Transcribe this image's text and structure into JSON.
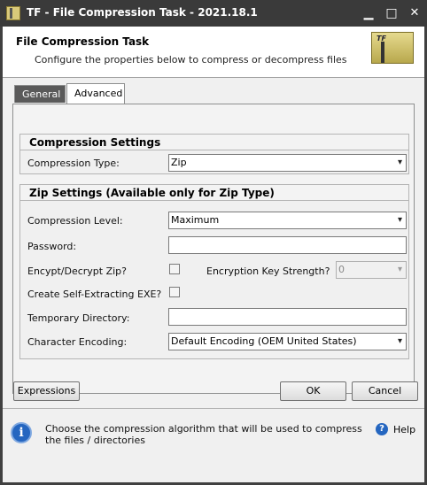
{
  "window": {
    "title": "TF - File Compression Task - 2021.18.1",
    "controls": {
      "minimize": "▁",
      "maximize": "□",
      "close": "✕"
    }
  },
  "header": {
    "title": "File Compression Task",
    "subtitle": "Configure the properties below to compress or decompress files"
  },
  "tabs": [
    {
      "label": "General",
      "selected": false
    },
    {
      "label": "Advanced",
      "selected": true
    }
  ],
  "compression_settings": {
    "heading": "Compression Settings",
    "type_label": "Compression Type:",
    "type_value": "Zip"
  },
  "zip_settings": {
    "heading": "Zip Settings (Available only for Zip Type)",
    "level_label": "Compression Level:",
    "level_value": "Maximum",
    "password_label": "Password:",
    "password_value": "",
    "encrypt_label": "Encypt/Decrypt Zip?",
    "encrypt_checked": false,
    "key_strength_label": "Encryption Key Strength?",
    "key_strength_value": "0",
    "self_extract_label": "Create Self-Extracting EXE?",
    "self_extract_checked": false,
    "temp_dir_label": "Temporary Directory:",
    "temp_dir_value": "",
    "encoding_label": "Character Encoding:",
    "encoding_value": "Default Encoding (OEM United States)"
  },
  "buttons": {
    "expressions": "Expressions",
    "ok": "OK",
    "cancel": "Cancel"
  },
  "info": {
    "text": "Choose the compression algorithm that will be used to compress the files / directories",
    "help_label": "Help",
    "icon_glyph": "i",
    "help_glyph": "?"
  }
}
